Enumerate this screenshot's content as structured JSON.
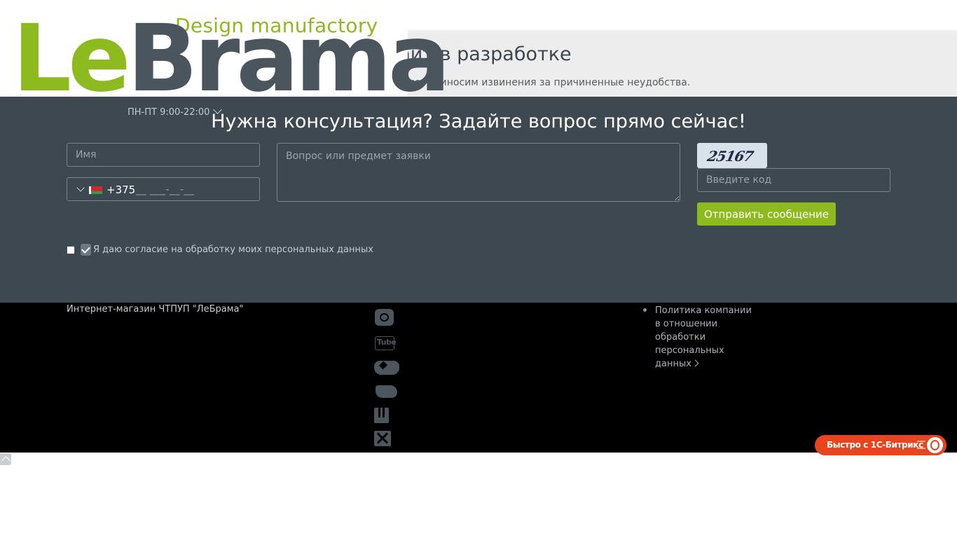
{
  "logo": {
    "tagline": "Design manufactory",
    "name_part1": "Le",
    "name_part2": "Brama"
  },
  "dev_banner": {
    "title": "Сайт в разработке",
    "subtitle": "Сайт находится в разработке. Приносим извинения за причиненные неудобства."
  },
  "header": {
    "hours": "ПН-ПТ 9:00-22:00"
  },
  "consultation": {
    "title": "Нужна консультация? Задайте вопрос прямо сейчас!",
    "name_placeholder": "Имя",
    "phone_code": "+375",
    "phone_mask": "__ ___-__-__",
    "question_placeholder": "Вопрос или предмет заявки",
    "captcha_text": "25167",
    "code_placeholder": "Введите код",
    "submit_label": "Отправить сообщение",
    "consent_label": "Я даю согласие на обработку моих персональных данных"
  },
  "footer": {
    "company": "Интернет-магазин ЧТПУП \"ЛеБрама\"",
    "social": [
      "instagram-icon",
      "youtube-icon",
      "vk-icon",
      "twitter-icon",
      "odnoklassniki-icon",
      "x-icon"
    ],
    "policy_link": "Политика компании в отношении обработки персональных данных"
  },
  "bitrix": {
    "label": "Быстро с 1С-Битрикс"
  },
  "colors": {
    "brand_green": "#8dba1e",
    "brand_gray": "#4a555d",
    "form_bg": "#3d4850",
    "bitrix_orange": "#e8441d"
  }
}
